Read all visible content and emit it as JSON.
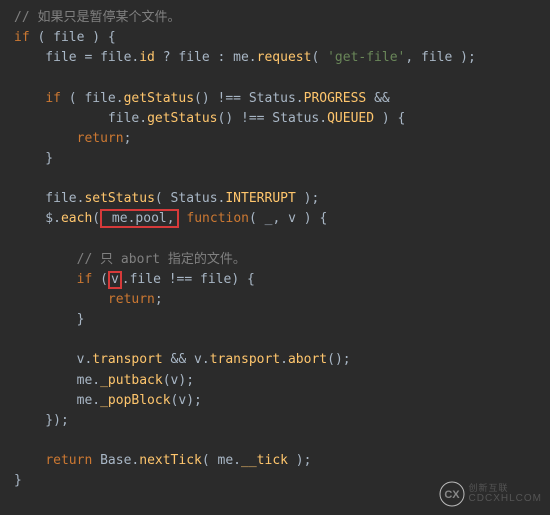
{
  "code": {
    "l1_comment": "// 如果只是暂停某个文件。",
    "l2_if": "if",
    "l2_cond_open": " ( ",
    "l2_file": "file",
    "l2_cond_close": " ) {",
    "l3_prefix": "    file = file.",
    "l3_id": "id",
    "l3_mid": " ? file : me.",
    "l3_request": "request",
    "l3_paren": "( ",
    "l3_str": "'get-file'",
    "l3_end": ", file );",
    "l5_prefix": "    ",
    "l5_if": "if",
    "l5_open": " ( file.",
    "l5_getStatus": "getStatus",
    "l5_mid": "() !== Status.",
    "l5_progress": "PROGRESS",
    "l5_amp": " &&",
    "l6_indent": "            file.",
    "l6_getStatus": "getStatus",
    "l6_mid": "() !== Status.",
    "l6_queued": "QUEUED",
    "l6_close": " ) {",
    "l7_indent": "        ",
    "l7_return": "return",
    "l7_semi": ";",
    "l8_close": "    }",
    "l10_prefix": "    file.",
    "l10_setStatus": "setStatus",
    "l10_open": "( Status.",
    "l10_interrupt": "INTERRUPT",
    "l10_close": " );",
    "l11_prefix": "    $.",
    "l11_each": "each",
    "l11_open": "(",
    "l11_pool": " me.pool,",
    "l11_func": " function",
    "l11_args": "( _, v ) {",
    "l13_comment": "        // 只 abort 指定的文件。",
    "l14_indent": "        ",
    "l14_if": "if",
    "l14_open": " (",
    "l14_v": "v",
    "l14_dot": ".",
    "l14_cond": "file !== file) {",
    "l15_indent": "            ",
    "l15_return": "return",
    "l15_semi": ";",
    "l16_close": "        }",
    "l18_prefix": "        v.",
    "l18_transport1": "transport",
    "l18_and": " && v.",
    "l18_transport2": "transport",
    "l18_dot": ".",
    "l18_abort": "abort",
    "l18_end": "();",
    "l19_prefix": "        me.",
    "l19_putback": "_putback",
    "l19_arg": "(v);",
    "l20_prefix": "        me.",
    "l20_popblock": "_popBlock",
    "l20_arg": "(v);",
    "l21_close": "    });",
    "l23_indent": "    ",
    "l23_return": "return",
    "l23_base": " Base.",
    "l23_nexttick": "nextTick",
    "l23_open": "( me.",
    "l23_tick": "__tick",
    "l23_close": " );",
    "l24_brace": "}"
  },
  "logo": {
    "brand_cn": "创新互联",
    "brand_en": "CDCXHLCOM"
  }
}
